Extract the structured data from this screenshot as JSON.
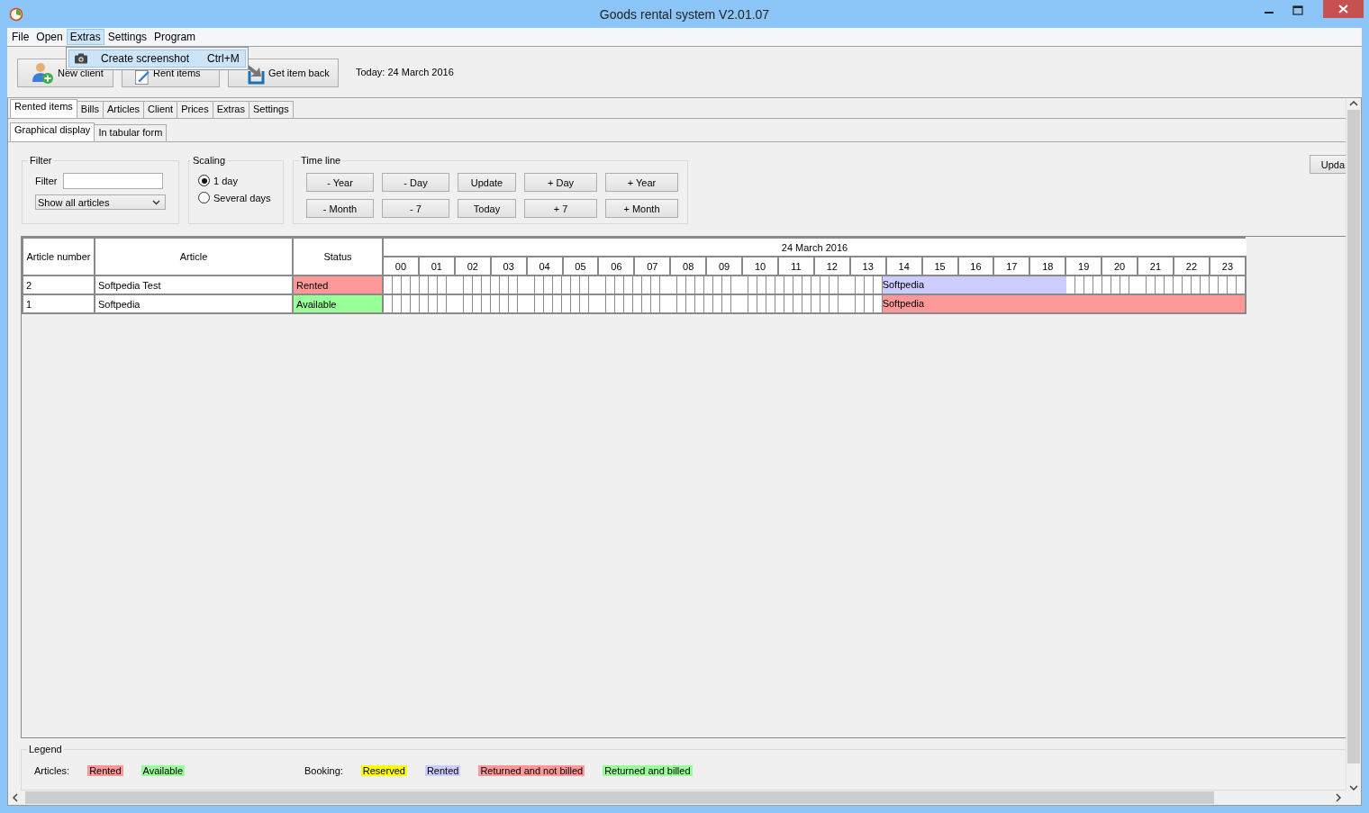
{
  "window": {
    "title": "Goods rental system V2.01.07"
  },
  "menu": [
    {
      "label": "File",
      "selected": false
    },
    {
      "label": "Open",
      "selected": false
    },
    {
      "label": "Extras",
      "selected": true
    },
    {
      "label": "Settings",
      "selected": false
    },
    {
      "label": "Program",
      "selected": false
    }
  ],
  "open_menu": {
    "items": [
      {
        "label": "Create screenshot",
        "shortcut": "Ctrl+M"
      }
    ]
  },
  "toolbar": {
    "buttons": [
      {
        "label": "New client",
        "kind": "client"
      },
      {
        "label": "Rent items",
        "kind": "rent"
      },
      {
        "label": "Get item back",
        "kind": "back"
      }
    ],
    "today": "Today: 24 March 2016"
  },
  "tabs": [
    {
      "label": "Rented items",
      "selected": true
    },
    {
      "label": "Bills",
      "selected": false
    },
    {
      "label": "Articles",
      "selected": false
    },
    {
      "label": "Client",
      "selected": false
    },
    {
      "label": "Prices",
      "selected": false
    },
    {
      "label": "Extras",
      "selected": false
    },
    {
      "label": "Settings",
      "selected": false
    }
  ],
  "subtabs": [
    {
      "label": "Graphical display",
      "selected": true
    },
    {
      "label": "In tabular form",
      "selected": false
    }
  ],
  "filter": {
    "title": "Filter",
    "label": "Filter",
    "dropdown": "Show all articles"
  },
  "scaling": {
    "title": "Scaling",
    "options": [
      {
        "label": "1 day",
        "selected": true
      },
      {
        "label": "Several days",
        "selected": false
      }
    ]
  },
  "timeline": {
    "title": "Time line",
    "rows": [
      {
        "buttons": [
          "- Year",
          "- Day",
          "Update",
          "+ Day",
          "+ Year"
        ]
      },
      {
        "buttons": [
          "- Month",
          "- 7",
          "Today",
          "+ 7",
          "+ Month"
        ]
      }
    ]
  },
  "side_button": "Upda",
  "table": {
    "columns": [
      "Article number",
      "Article",
      "Status"
    ],
    "date": "24 March 2016",
    "hours": [
      "00",
      "01",
      "02",
      "03",
      "04",
      "05",
      "06",
      "07",
      "08",
      "09",
      "10",
      "11",
      "12",
      "13",
      "14",
      "15",
      "16",
      "17",
      "18",
      "19",
      "20",
      "21",
      "22",
      "23"
    ],
    "rows": [
      {
        "number": "2",
        "article": "Softpedia Test",
        "status": {
          "label": "Rented",
          "color": "#ff9999"
        },
        "slots": [
          {
            "booked": false
          },
          {
            "booked": false
          },
          {
            "booked": false
          },
          {
            "booked": false
          },
          {
            "booked": false
          },
          {
            "booked": false
          },
          {
            "booked": false
          },
          {
            "booked": false
          },
          {
            "booked": false
          },
          {
            "booked": false
          },
          {
            "booked": false
          },
          {
            "booked": false
          },
          {
            "booked": false
          },
          {
            "booked": false
          },
          {
            "booked": true,
            "color": "#ccccff",
            "label": "Softpedia"
          },
          {
            "booked": true,
            "color": "#ccccff"
          },
          {
            "booked": true,
            "color": "#ccccff"
          },
          {
            "booked": true,
            "color": "#ccccff"
          },
          {
            "booked": true,
            "color": "#ccccff"
          },
          {
            "booked": false
          },
          {
            "booked": false
          },
          {
            "booked": false
          },
          {
            "booked": false
          },
          {
            "booked": false
          }
        ]
      },
      {
        "number": "1",
        "article": "Softpedia",
        "status": {
          "label": "Available",
          "color": "#99ff99"
        },
        "slots": [
          {
            "booked": false
          },
          {
            "booked": false
          },
          {
            "booked": false
          },
          {
            "booked": false
          },
          {
            "booked": false
          },
          {
            "booked": false
          },
          {
            "booked": false
          },
          {
            "booked": false
          },
          {
            "booked": false
          },
          {
            "booked": false
          },
          {
            "booked": false
          },
          {
            "booked": false
          },
          {
            "booked": false
          },
          {
            "booked": false
          },
          {
            "booked": true,
            "color": "#ff9999",
            "label": "Softpedia"
          },
          {
            "booked": true,
            "color": "#ff9999"
          },
          {
            "booked": true,
            "color": "#ff9999"
          },
          {
            "booked": true,
            "color": "#ff9999"
          },
          {
            "booked": true,
            "color": "#ff9999"
          },
          {
            "booked": true,
            "color": "#ff9999"
          },
          {
            "booked": true,
            "color": "#ff9999"
          },
          {
            "booked": true,
            "color": "#ff9999"
          },
          {
            "booked": true,
            "color": "#ff9999"
          },
          {
            "booked": true,
            "color": "#ff9999"
          }
        ]
      }
    ]
  },
  "legend": {
    "title": "Legend",
    "groups": [
      {
        "label": "Articles:",
        "items": [
          {
            "label": "Rented",
            "color": "#ff9999"
          },
          {
            "label": "Available",
            "color": "#99ff99"
          }
        ]
      },
      {
        "label": "Booking:",
        "items": [
          {
            "label": "Reserved",
            "color": "#ffff00"
          },
          {
            "label": "Rented",
            "color": "#ccccff"
          },
          {
            "label": "Returned and not billed",
            "color": "#ff9999"
          },
          {
            "label": "Returned and billed",
            "color": "#99ff99"
          }
        ]
      }
    ]
  }
}
